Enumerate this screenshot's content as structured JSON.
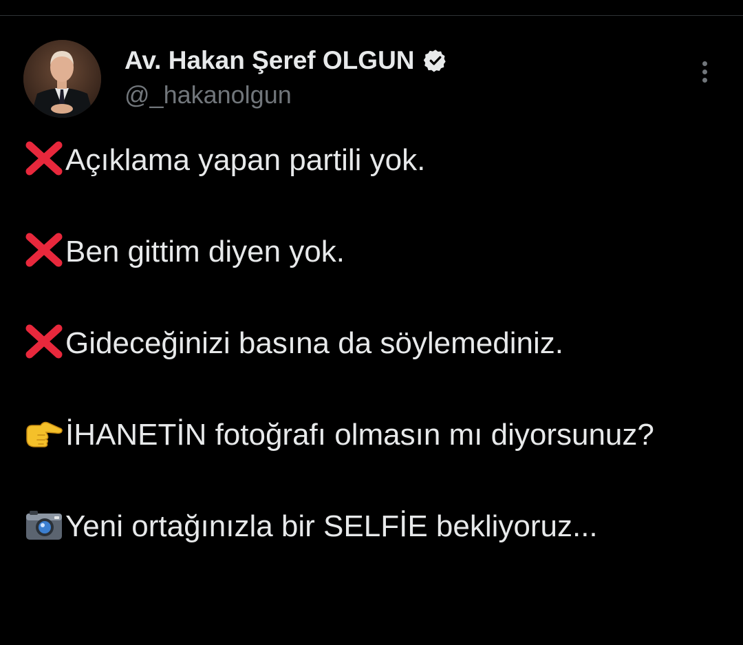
{
  "author": {
    "display_name": "Av. Hakan Şeref OLGUN",
    "handle": "@_hakanolgun",
    "verified": true
  },
  "icons": {
    "avatar": "profile-photo",
    "verified": "verified-badge-icon",
    "more": "more-options-icon"
  },
  "tweet": {
    "lines": [
      {
        "emoji": "cross-mark-emoji",
        "text": "Açıklama yapan partili yok."
      },
      {
        "emoji": "cross-mark-emoji",
        "text": "Ben gittim diyen yok."
      },
      {
        "emoji": "cross-mark-emoji",
        "text": "Gideceğinizi basına da söylemediniz."
      },
      {
        "emoji": "pointing-right-emoji",
        "text": "İHANETİN fotoğrafı olmasın mı diyorsunuz?"
      },
      {
        "emoji": "camera-emoji",
        "text": "Yeni ortağınızla bir SELFİE bekliyoruz..."
      }
    ]
  },
  "colors": {
    "background": "#000000",
    "text_primary": "#e7e9ea",
    "text_secondary": "#71767b",
    "cross_mark": "#e8283c"
  }
}
